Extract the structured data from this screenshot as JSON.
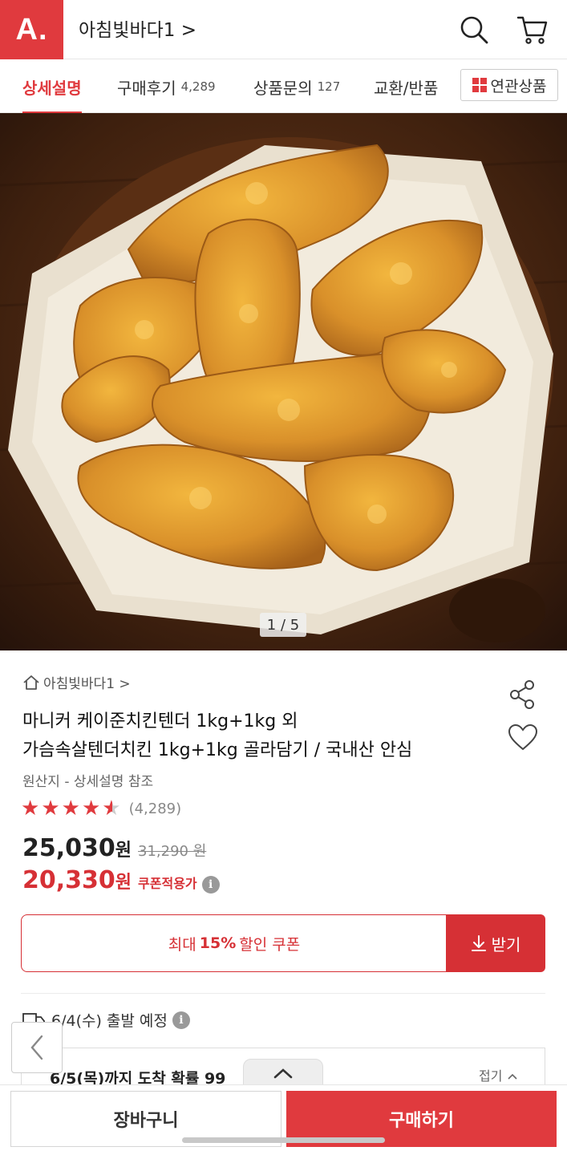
{
  "header": {
    "logo": "A.",
    "store_name": "아침빛바다1 >"
  },
  "tabs": [
    {
      "label": "상세설명",
      "count": ""
    },
    {
      "label": "구매후기",
      "count": "4,289"
    },
    {
      "label": "상품문의",
      "count": "127"
    },
    {
      "label": "교환/반품",
      "count": ""
    }
  ],
  "related_button": "연관상품",
  "image": {
    "counter": "1 / 5",
    "description_icon": "fried-chicken-tenders-photo"
  },
  "product": {
    "breadcrumb": "아침빛바다1 >",
    "title_line1": "마니커 케이준치킨텐더 1kg+1kg 외",
    "title_line2": "가슴속살텐더치킨 1kg+1kg 골라담기 / 국내산 안심",
    "origin": "원산지 - 상세설명 참조",
    "rating": 4.5,
    "review_count": "(4,289)",
    "price": "25,030",
    "price_unit": "원",
    "original_price": "31,290 원",
    "coupon_price": "20,330",
    "coupon_price_unit": "원",
    "coupon_tag": "쿠폰적용가"
  },
  "coupon": {
    "prefix": "최대",
    "percent": "15%",
    "suffix": "할인 쿠폰",
    "download_label": "받기"
  },
  "shipping": {
    "depart": "6/4(수) 출발 예정",
    "arrive": "6/5(목)까지 도착 확률 99",
    "collapse": "접기"
  },
  "bottom": {
    "cart_label": "장바구니",
    "buy_label": "구매하기"
  },
  "colors": {
    "brand": "#e03a3e",
    "price_red": "#d63035"
  }
}
